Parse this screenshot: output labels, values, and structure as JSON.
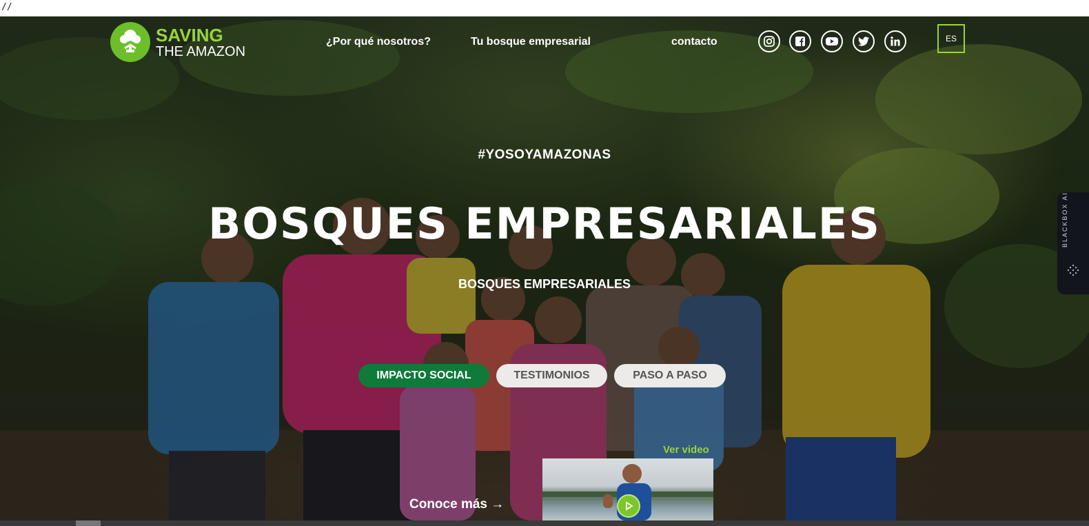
{
  "browser": {
    "address_text": "//"
  },
  "header": {
    "logo": {
      "line1": "SAVING",
      "line2": "THE AMAZON",
      "icon": "tree-people-logo"
    },
    "nav": [
      {
        "label": "¿Por qué nosotros?"
      },
      {
        "label": "Tu bosque empresarial"
      },
      {
        "label": "contacto"
      }
    ],
    "social_icons": [
      "instagram-icon",
      "facebook-icon",
      "youtube-icon",
      "twitter-icon",
      "linkedin-icon"
    ],
    "language": "ES"
  },
  "hero": {
    "hashtag": "#YOSOYAMAZONAS",
    "title": "BOSQUES EMPRESARIALES",
    "subtitle": "BOSQUES EMPRESARIALES",
    "tabs": [
      {
        "label": "IMPACTO SOCIAL",
        "active": true
      },
      {
        "label": "TESTIMONIOS",
        "active": false
      },
      {
        "label": "PASO A PASO",
        "active": false
      }
    ],
    "video_link": "Ver video",
    "cta": "Conoce más →"
  },
  "side_widget": {
    "label": "BLACKBOX AI"
  },
  "colors": {
    "brand_green": "#9ad43a",
    "active_tab": "#0f7a3a",
    "inactive_tab": "#ecebea"
  }
}
